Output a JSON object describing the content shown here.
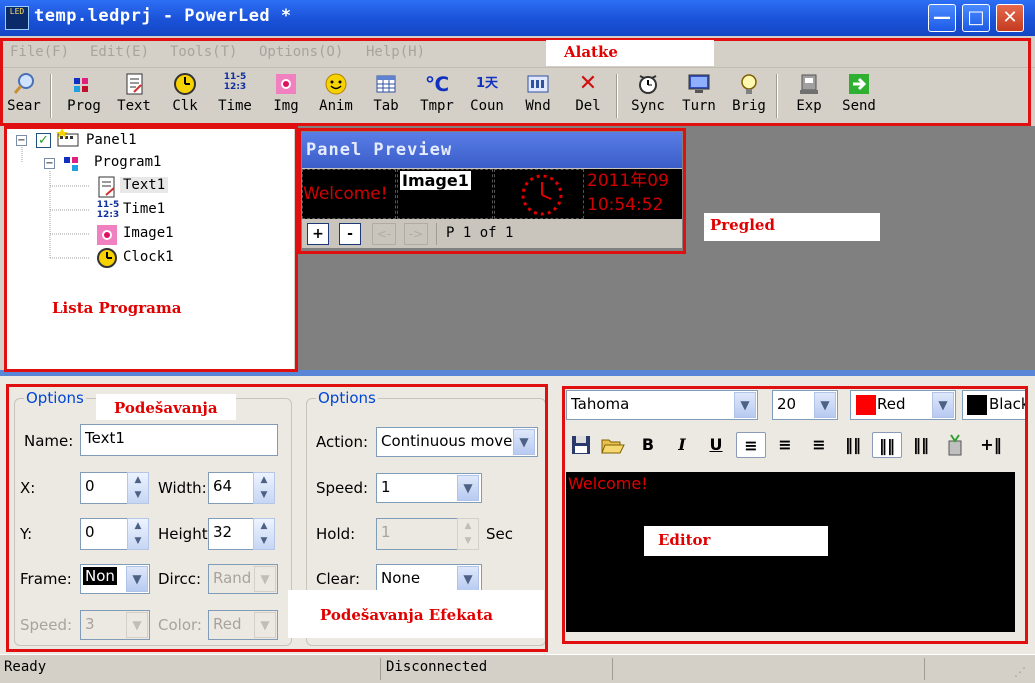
{
  "window": {
    "title": "temp.ledprj - PowerLed *",
    "app_icon_text": "LED",
    "minimize": "—",
    "maximize": "□",
    "close": "✕"
  },
  "menu": [
    "File(F)",
    "Edit(E)",
    "Tools(T)",
    "Options(O)",
    "Help(H)"
  ],
  "toolbar": [
    {
      "label": "Sear",
      "icon": "search-icon"
    },
    {
      "label": "Prog",
      "icon": "program-icon"
    },
    {
      "label": "Text",
      "icon": "text-icon"
    },
    {
      "label": "Clk",
      "icon": "clock-icon"
    },
    {
      "label": "Time",
      "icon": "time-icon"
    },
    {
      "label": "Img",
      "icon": "image-icon"
    },
    {
      "label": "Anim",
      "icon": "animation-icon"
    },
    {
      "label": "Tab",
      "icon": "table-icon"
    },
    {
      "label": "Tmpr",
      "icon": "temperature-icon"
    },
    {
      "label": "Coun",
      "icon": "counter-icon"
    },
    {
      "label": "Wnd",
      "icon": "window-icon"
    },
    {
      "label": "Del",
      "icon": "delete-icon"
    },
    {
      "label": "Sync",
      "icon": "sync-icon"
    },
    {
      "label": "Turn",
      "icon": "turn-icon"
    },
    {
      "label": "Brig",
      "icon": "brightness-icon"
    },
    {
      "label": "Exp",
      "icon": "export-icon"
    },
    {
      "label": "Send",
      "icon": "send-icon"
    }
  ],
  "toolbar_icon_text": {
    "time": "11-5\n12:3",
    "temperature": "℃",
    "counter": "1天"
  },
  "tree": {
    "panel": "Panel1",
    "program": "Program1",
    "items": [
      "Text1",
      "Time1",
      "Image1",
      "Clock1"
    ]
  },
  "preview": {
    "title": "Panel Preview",
    "welcome": "Welcome!",
    "image_label": "Image1",
    "date": "2011年09",
    "time": "10:54:52",
    "page": "P 1 of 1",
    "zoom_in": "+",
    "zoom_out": "-",
    "prev": "<-",
    "next": "->"
  },
  "options_left": {
    "title": "Options",
    "name_label": "Name:",
    "name_value": "Text1",
    "x_label": "X:",
    "x_value": "0",
    "width_label": "Width:",
    "width_value": "64",
    "y_label": "Y:",
    "y_value": "0",
    "height_label": "Height",
    "height_value": "32",
    "frame_label": "Frame:",
    "frame_value": "Non",
    "dircc_label": "Dircc:",
    "dircc_value": "Rand",
    "speed_label": "Speed:",
    "speed_value": "3",
    "color_label": "Color:",
    "color_value": "Red"
  },
  "options_right": {
    "title": "Options",
    "action_label": "Action:",
    "action_value": "Continuous move",
    "speed_label": "Speed:",
    "speed_value": "1",
    "hold_label": "Hold:",
    "hold_value": "1",
    "hold_unit": "Sec",
    "clear_label": "Clear:",
    "clear_value": "None"
  },
  "editor": {
    "font": "Tahoma",
    "size": "20",
    "fg_color_name": "Red",
    "bg_color_name": "Black",
    "fg_color": "#ff0000",
    "bg_color": "#000000",
    "content": "Welcome!",
    "bold": "B",
    "italic": "I",
    "underline": "U"
  },
  "annotations": {
    "alatke": "Alatke",
    "pregled": "Pregled",
    "lista": "Lista Programa",
    "podesavanja": "Podešavanja",
    "efekti": "Podešavanja Efekata",
    "editor": "Editor"
  },
  "status": {
    "left": "Ready",
    "middle": "Disconnected"
  },
  "colors": {
    "annotation_red": "#e01010",
    "led_red": "#e00000",
    "titlebar_blue": "#1a52d8"
  }
}
